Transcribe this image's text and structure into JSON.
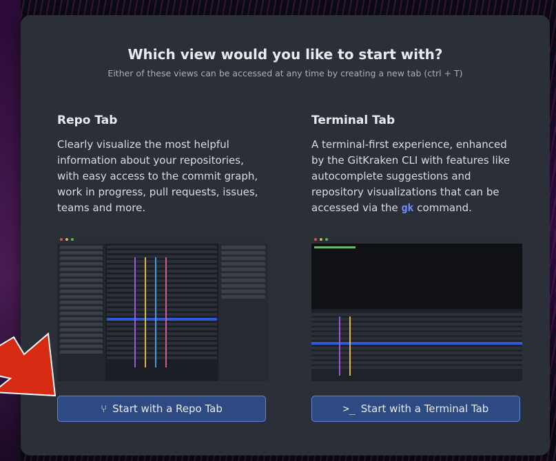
{
  "dialog": {
    "title": "Which view would you like to start with?",
    "subtitle": "Either of these views can be accessed at any time by creating a new tab (ctrl + T)"
  },
  "repo": {
    "heading": "Repo Tab",
    "description": "Clearly visualize the most helpful information about your repositories, with easy access to the commit graph, work in progress, pull requests, issues, teams and more.",
    "button_label": "Start with a Repo Tab",
    "button_icon": "git-branch-icon"
  },
  "terminal": {
    "heading": "Terminal Tab",
    "description_pre": "A terminal-first experience, enhanced by the GitKraken CLI with features like autocomplete suggestions and repository visualizations that can be accessed via the ",
    "command": "gk",
    "description_post": " command.",
    "button_label": "Start with a Terminal Tab",
    "button_icon": "terminal-prompt-icon"
  },
  "colors": {
    "dialog_bg": "#2b3038",
    "button_bg": "#2e4a82",
    "button_border": "#5f86d6",
    "command_color": "#6f8cff",
    "arrow_color": "#d62a12"
  }
}
